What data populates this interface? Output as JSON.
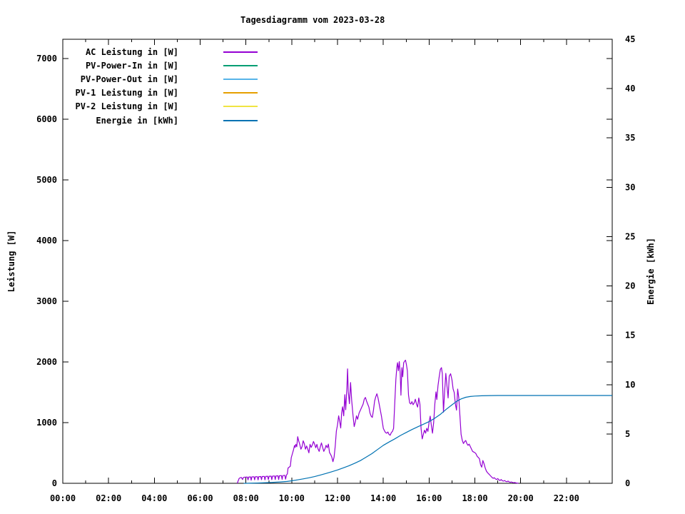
{
  "page": {
    "background": "#ffffff",
    "axis_color": "#000000"
  },
  "chart_data": {
    "type": "line",
    "title": "Tagesdiagramm vom 2023-03-28",
    "grid": false,
    "legend_position": "top-left-inside",
    "x_axis": {
      "unit": "time-of-day",
      "range_hours": [
        0,
        24
      ],
      "major_tick_hours": 2,
      "minor_tick_hours": 1,
      "tick_labels": [
        "00:00",
        "02:00",
        "04:00",
        "06:00",
        "08:00",
        "10:00",
        "12:00",
        "14:00",
        "16:00",
        "18:00",
        "20:00",
        "22:00"
      ]
    },
    "y_left_axis": {
      "label": "Leistung [W]",
      "range": [
        0,
        7320
      ],
      "tick_step": 1000,
      "tick_labels": [
        "0",
        "1000",
        "2000",
        "3000",
        "4000",
        "5000",
        "6000",
        "7000"
      ]
    },
    "y_right_axis": {
      "label": "Energie [kWh]",
      "range": [
        0,
        45
      ],
      "tick_step": 5,
      "tick_labels": [
        "0",
        "5",
        "10",
        "15",
        "20",
        "25",
        "30",
        "35",
        "40",
        "45"
      ]
    },
    "series": [
      {
        "name": "AC Leistung in [W]",
        "color": "#9400D3",
        "axis": "left",
        "points": [
          [
            7.62,
            0
          ],
          [
            7.66,
            40
          ],
          [
            7.7,
            78
          ],
          [
            7.75,
            92
          ],
          [
            7.8,
            96
          ],
          [
            7.85,
            62
          ],
          [
            7.89,
            96
          ],
          [
            7.94,
            100
          ],
          [
            8.0,
            102
          ],
          [
            8.06,
            104
          ],
          [
            8.09,
            56
          ],
          [
            8.12,
            104
          ],
          [
            8.2,
            106
          ],
          [
            8.23,
            52
          ],
          [
            8.26,
            106
          ],
          [
            8.35,
            108
          ],
          [
            8.38,
            58
          ],
          [
            8.41,
            108
          ],
          [
            8.5,
            110
          ],
          [
            8.53,
            56
          ],
          [
            8.56,
            110
          ],
          [
            8.65,
            112
          ],
          [
            8.68,
            60
          ],
          [
            8.71,
            112
          ],
          [
            8.8,
            114
          ],
          [
            8.83,
            58
          ],
          [
            8.86,
            114
          ],
          [
            8.95,
            116
          ],
          [
            8.98,
            62
          ],
          [
            9.01,
            116
          ],
          [
            9.1,
            118
          ],
          [
            9.13,
            60
          ],
          [
            9.16,
            118
          ],
          [
            9.25,
            121
          ],
          [
            9.28,
            64
          ],
          [
            9.31,
            121
          ],
          [
            9.4,
            124
          ],
          [
            9.43,
            62
          ],
          [
            9.46,
            124
          ],
          [
            9.55,
            127
          ],
          [
            9.58,
            66
          ],
          [
            9.61,
            127
          ],
          [
            9.7,
            132
          ],
          [
            9.73,
            68
          ],
          [
            9.77,
            136
          ],
          [
            9.81,
            155
          ],
          [
            9.84,
            252
          ],
          [
            9.89,
            266
          ],
          [
            9.94,
            282
          ],
          [
            9.98,
            424
          ],
          [
            10.03,
            488
          ],
          [
            10.08,
            556
          ],
          [
            10.12,
            622
          ],
          [
            10.15,
            592
          ],
          [
            10.18,
            642
          ],
          [
            10.22,
            602
          ],
          [
            10.26,
            768
          ],
          [
            10.3,
            704
          ],
          [
            10.35,
            642
          ],
          [
            10.4,
            562
          ],
          [
            10.45,
            602
          ],
          [
            10.5,
            700
          ],
          [
            10.55,
            652
          ],
          [
            10.6,
            562
          ],
          [
            10.65,
            616
          ],
          [
            10.7,
            562
          ],
          [
            10.75,
            502
          ],
          [
            10.8,
            642
          ],
          [
            10.85,
            592
          ],
          [
            10.9,
            632
          ],
          [
            10.95,
            690
          ],
          [
            11.0,
            646
          ],
          [
            11.05,
            586
          ],
          [
            11.1,
            642
          ],
          [
            11.15,
            566
          ],
          [
            11.2,
            526
          ],
          [
            11.25,
            602
          ],
          [
            11.3,
            666
          ],
          [
            11.35,
            596
          ],
          [
            11.4,
            526
          ],
          [
            11.45,
            566
          ],
          [
            11.5,
            626
          ],
          [
            11.55,
            586
          ],
          [
            11.6,
            646
          ],
          [
            11.65,
            506
          ],
          [
            11.7,
            476
          ],
          [
            11.75,
            432
          ],
          [
            11.8,
            356
          ],
          [
            11.85,
            432
          ],
          [
            11.9,
            612
          ],
          [
            11.95,
            862
          ],
          [
            12.0,
            962
          ],
          [
            12.05,
            1112
          ],
          [
            12.1,
            1012
          ],
          [
            12.14,
            912
          ],
          [
            12.18,
            1162
          ],
          [
            12.22,
            1262
          ],
          [
            12.27,
            1112
          ],
          [
            12.32,
            1462
          ],
          [
            12.36,
            1212
          ],
          [
            12.41,
            1580
          ],
          [
            12.44,
            1886
          ],
          [
            12.47,
            1512
          ],
          [
            12.52,
            1312
          ],
          [
            12.57,
            1662
          ],
          [
            12.62,
            1362
          ],
          [
            12.68,
            1112
          ],
          [
            12.73,
            936
          ],
          [
            12.78,
            1012
          ],
          [
            12.83,
            1112
          ],
          [
            12.88,
            1056
          ],
          [
            12.94,
            1156
          ],
          [
            13.0,
            1206
          ],
          [
            13.06,
            1256
          ],
          [
            13.12,
            1306
          ],
          [
            13.17,
            1386
          ],
          [
            13.22,
            1416
          ],
          [
            13.27,
            1356
          ],
          [
            13.32,
            1306
          ],
          [
            13.37,
            1256
          ],
          [
            13.42,
            1156
          ],
          [
            13.47,
            1106
          ],
          [
            13.52,
            1086
          ],
          [
            13.57,
            1206
          ],
          [
            13.62,
            1356
          ],
          [
            13.67,
            1426
          ],
          [
            13.72,
            1476
          ],
          [
            13.77,
            1406
          ],
          [
            13.82,
            1306
          ],
          [
            13.87,
            1206
          ],
          [
            13.92,
            1106
          ],
          [
            13.96,
            1006
          ],
          [
            14.0,
            906
          ],
          [
            14.05,
            866
          ],
          [
            14.1,
            836
          ],
          [
            14.15,
            826
          ],
          [
            14.2,
            846
          ],
          [
            14.25,
            806
          ],
          [
            14.3,
            792
          ],
          [
            14.35,
            836
          ],
          [
            14.4,
            856
          ],
          [
            14.45,
            906
          ],
          [
            14.5,
            1312
          ],
          [
            14.55,
            1712
          ],
          [
            14.59,
            1906
          ],
          [
            14.62,
            1988
          ],
          [
            14.66,
            1856
          ],
          [
            14.7,
            2006
          ],
          [
            14.74,
            1806
          ],
          [
            14.77,
            1452
          ],
          [
            14.81,
            1906
          ],
          [
            14.85,
            1756
          ],
          [
            14.89,
            1986
          ],
          [
            14.93,
            2012
          ],
          [
            14.97,
            2030
          ],
          [
            15.01,
            1956
          ],
          [
            15.05,
            1856
          ],
          [
            15.1,
            1456
          ],
          [
            15.15,
            1326
          ],
          [
            15.2,
            1306
          ],
          [
            15.25,
            1346
          ],
          [
            15.3,
            1296
          ],
          [
            15.35,
            1326
          ],
          [
            15.4,
            1386
          ],
          [
            15.45,
            1306
          ],
          [
            15.5,
            1256
          ],
          [
            15.55,
            1406
          ],
          [
            15.6,
            1306
          ],
          [
            15.65,
            906
          ],
          [
            15.7,
            732
          ],
          [
            15.75,
            806
          ],
          [
            15.8,
            876
          ],
          [
            15.85,
            826
          ],
          [
            15.9,
            906
          ],
          [
            15.95,
            856
          ],
          [
            16.0,
            1006
          ],
          [
            16.05,
            1106
          ],
          [
            16.1,
            956
          ],
          [
            16.15,
            826
          ],
          [
            16.2,
            1006
          ],
          [
            16.25,
            1306
          ],
          [
            16.3,
            1506
          ],
          [
            16.34,
            1380
          ],
          [
            16.39,
            1606
          ],
          [
            16.44,
            1756
          ],
          [
            16.49,
            1876
          ],
          [
            16.54,
            1906
          ],
          [
            16.58,
            1806
          ],
          [
            16.63,
            1172
          ],
          [
            16.68,
            1506
          ],
          [
            16.73,
            1812
          ],
          [
            16.78,
            1606
          ],
          [
            16.83,
            1406
          ],
          [
            16.88,
            1766
          ],
          [
            16.94,
            1806
          ],
          [
            17.0,
            1706
          ],
          [
            17.05,
            1556
          ],
          [
            17.1,
            1496
          ],
          [
            17.15,
            1306
          ],
          [
            17.2,
            1206
          ],
          [
            17.25,
            1553
          ],
          [
            17.3,
            1406
          ],
          [
            17.35,
            1106
          ],
          [
            17.4,
            806
          ],
          [
            17.45,
            706
          ],
          [
            17.5,
            656
          ],
          [
            17.55,
            686
          ],
          [
            17.6,
            706
          ],
          [
            17.65,
            656
          ],
          [
            17.7,
            626
          ],
          [
            17.75,
            646
          ],
          [
            17.8,
            606
          ],
          [
            17.85,
            566
          ],
          [
            17.9,
            526
          ],
          [
            17.95,
            516
          ],
          [
            18.0,
            506
          ],
          [
            18.05,
            486
          ],
          [
            18.1,
            446
          ],
          [
            18.15,
            426
          ],
          [
            18.2,
            406
          ],
          [
            18.25,
            306
          ],
          [
            18.3,
            266
          ],
          [
            18.35,
            376
          ],
          [
            18.4,
            326
          ],
          [
            18.45,
            256
          ],
          [
            18.5,
            206
          ],
          [
            18.55,
            176
          ],
          [
            18.6,
            156
          ],
          [
            18.65,
            136
          ],
          [
            18.7,
            116
          ],
          [
            18.75,
            96
          ],
          [
            18.8,
            82
          ],
          [
            18.85,
            92
          ],
          [
            18.9,
            72
          ],
          [
            18.95,
            62
          ],
          [
            19.0,
            78
          ],
          [
            19.05,
            56
          ],
          [
            19.1,
            46
          ],
          [
            19.15,
            62
          ],
          [
            19.2,
            42
          ],
          [
            19.25,
            36
          ],
          [
            19.3,
            46
          ],
          [
            19.35,
            32
          ],
          [
            19.4,
            26
          ],
          [
            19.45,
            36
          ],
          [
            19.5,
            22
          ],
          [
            19.55,
            16
          ],
          [
            19.6,
            22
          ],
          [
            19.65,
            13
          ],
          [
            19.7,
            9
          ],
          [
            19.75,
            13
          ],
          [
            19.8,
            6
          ],
          [
            19.85,
            3
          ],
          [
            19.9,
            0
          ]
        ]
      },
      {
        "name": "PV-Power-In in [W]",
        "color": "#009E73",
        "axis": "left",
        "points": []
      },
      {
        "name": "PV-Power-Out in [W]",
        "color": "#56B4E9",
        "axis": "left",
        "points": []
      },
      {
        "name": "PV-1 Leistung in [W]",
        "color": "#E69F00",
        "axis": "left",
        "points": []
      },
      {
        "name": "PV-2 Leistung in [W]",
        "color": "#F0E442",
        "axis": "left",
        "points": []
      },
      {
        "name": "Energie in [kWh]",
        "color": "#0072B2",
        "axis": "right",
        "points": [
          [
            7.9,
            0
          ],
          [
            8.5,
            0.03
          ],
          [
            9.0,
            0.07
          ],
          [
            9.5,
            0.14
          ],
          [
            9.8,
            0.19
          ],
          [
            10.0,
            0.25
          ],
          [
            10.25,
            0.35
          ],
          [
            10.5,
            0.45
          ],
          [
            10.75,
            0.56
          ],
          [
            11.0,
            0.68
          ],
          [
            11.25,
            0.84
          ],
          [
            11.5,
            1.0
          ],
          [
            11.75,
            1.17
          ],
          [
            12.0,
            1.35
          ],
          [
            12.25,
            1.56
          ],
          [
            12.5,
            1.78
          ],
          [
            12.75,
            2.03
          ],
          [
            13.0,
            2.3
          ],
          [
            13.25,
            2.65
          ],
          [
            13.5,
            3.0
          ],
          [
            13.75,
            3.42
          ],
          [
            14.0,
            3.85
          ],
          [
            14.25,
            4.18
          ],
          [
            14.5,
            4.5
          ],
          [
            14.75,
            4.85
          ],
          [
            15.0,
            5.15
          ],
          [
            15.25,
            5.45
          ],
          [
            15.5,
            5.72
          ],
          [
            15.75,
            5.98
          ],
          [
            16.0,
            6.25
          ],
          [
            16.25,
            6.6
          ],
          [
            16.5,
            7.0
          ],
          [
            16.75,
            7.5
          ],
          [
            17.0,
            7.95
          ],
          [
            17.2,
            8.3
          ],
          [
            17.4,
            8.55
          ],
          [
            17.6,
            8.72
          ],
          [
            17.8,
            8.8
          ],
          [
            18.0,
            8.84
          ],
          [
            18.3,
            8.87
          ],
          [
            18.7,
            8.89
          ],
          [
            19.0,
            8.9
          ],
          [
            20.0,
            8.9
          ],
          [
            22.0,
            8.9
          ],
          [
            24.0,
            8.9
          ]
        ]
      }
    ]
  }
}
